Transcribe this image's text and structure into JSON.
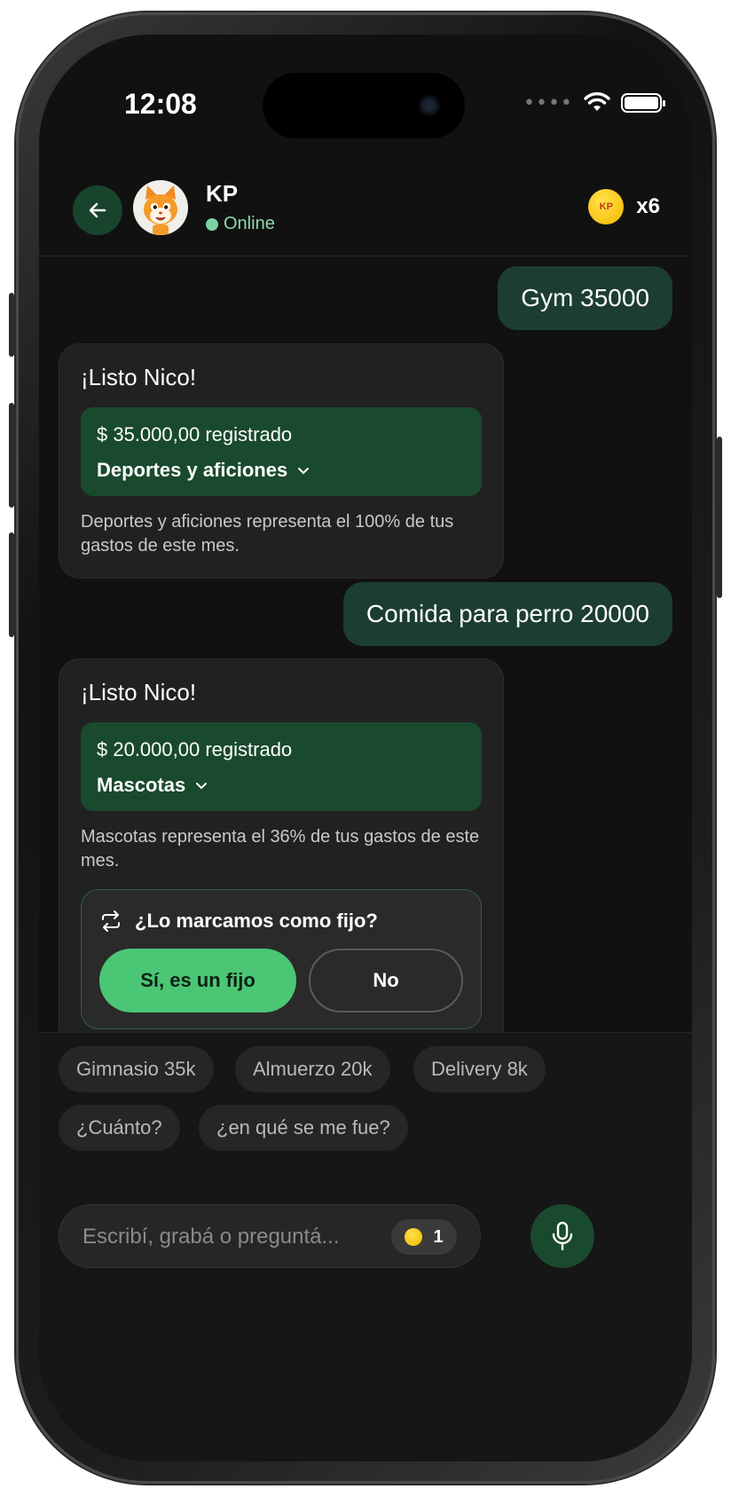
{
  "status_bar": {
    "time": "12:08",
    "icons": [
      "signal-icon",
      "wifi-icon",
      "battery-icon"
    ]
  },
  "header": {
    "back_icon": "arrow-left-icon",
    "avatar_icon": "cat-mascot-avatar",
    "name": "KP",
    "status": "Online",
    "coin_label": "KP",
    "coin_count": "x6"
  },
  "messages": [
    {
      "from": "user",
      "text": "Gym 35000"
    },
    {
      "from": "bot",
      "title": "¡Listo Nico!",
      "amount": "$ 35.000,00 registrado",
      "category": "Deportes y aficiones",
      "note": "Deportes y aficiones representa el 100% de tus gastos de este mes."
    },
    {
      "from": "user",
      "text": "Comida para perro 20000"
    },
    {
      "from": "bot",
      "title": "¡Listo Nico!",
      "amount": "$ 20.000,00 registrado",
      "category": "Mascotas",
      "note": "Mascotas representa el 36% de tus gastos de este mes.",
      "fixed_question": "¿Lo marcamos como fijo?",
      "yes_label": "Sí, es un fijo",
      "no_label": "No"
    }
  ],
  "quick_replies": [
    "Gimnasio 35k",
    "Almuerzo 20k",
    "Delivery 8k",
    "¿Cuánto?",
    "¿en qué se me fue?"
  ],
  "input": {
    "placeholder": "Escribí, grabá o preguntá...",
    "coin_count": "1"
  },
  "colors": {
    "accent_green": "#4bc674",
    "dark_green": "#1a4a2e",
    "user_bubble": "#1c3e30",
    "coin_yellow": "#f5b800"
  }
}
